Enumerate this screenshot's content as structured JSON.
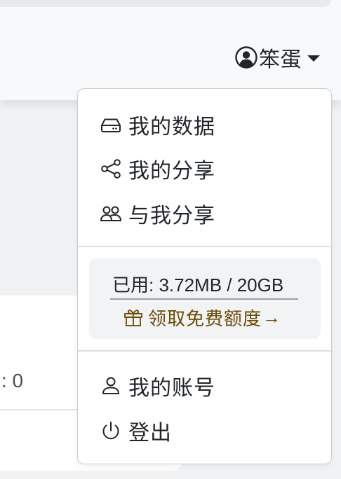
{
  "navbar": {
    "user_name": "笨蛋"
  },
  "background": {
    "count_text": ": 0"
  },
  "dropdown": {
    "items_top": [
      {
        "label": "我的数据",
        "icon": "hard-drive-icon"
      },
      {
        "label": "我的分享",
        "icon": "share-icon"
      },
      {
        "label": "与我分享",
        "icon": "people-icon"
      }
    ],
    "usage": {
      "text": "已用: 3.72MB / 20GB",
      "quota_link": "领取免费额度",
      "quota_arrow": "→"
    },
    "items_bottom": [
      {
        "label": "我的账号",
        "icon": "person-icon"
      },
      {
        "label": "登出",
        "icon": "power-icon"
      }
    ]
  },
  "colors": {
    "quota_link": "#6b4a06",
    "usage_background": "#f1f3f5",
    "page_background": "#f1f2f4"
  }
}
